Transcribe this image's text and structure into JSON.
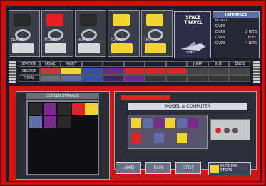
{
  "colors": {
    "bezel": "#cc1010",
    "panel_bg": "#1b1e28",
    "accent_red": "#d92727",
    "accent_yellow": "#f2d432",
    "accent_blue": "#5e6fa8"
  },
  "top_slots": [
    {
      "id": "slot-1",
      "label": "BLANK",
      "lamp": "#2a2a2a",
      "lamp_name": "black-lamp-icon"
    },
    {
      "id": "slot-2",
      "label": "MODE",
      "lamp": "#e81e25",
      "lamp_name": "red-lamp-icon"
    },
    {
      "id": "slot-3",
      "label": "ROAD",
      "lamp": "#2a2a2a",
      "lamp_name": "black-lamp-icon"
    },
    {
      "id": "slot-4",
      "label": "FORK",
      "lamp": "#f2d432",
      "lamp_name": "yellow-lamp-icon"
    },
    {
      "id": "slot-5",
      "label": "TRIP",
      "lamp": "#f2d432",
      "lamp_name": "yellow-lamp-icon"
    }
  ],
  "logo": {
    "title": "SPACE TRAVEL",
    "subtitle": "SHIP"
  },
  "stats": {
    "header": "INTERFACE",
    "rows": [
      {
        "k": "BOOST",
        "v": ""
      },
      {
        "k": "OVER",
        "v": ""
      },
      {
        "k": "OVER",
        "v": "2 BITS"
      },
      {
        "k": "OVER",
        "v": "FUEL"
      },
      {
        "k": "OVER",
        "v": "4 BITS"
      }
    ]
  },
  "grid": {
    "headers": [
      "STATION",
      "MOVE",
      "RIGHT",
      "",
      "",
      "",
      "",
      "",
      "JUMP",
      "BUG",
      "ENDS"
    ],
    "rows": [
      [
        "SECTOR",
        "",
        "",
        "",
        "",
        "",
        "",
        "",
        "",
        "",
        ""
      ],
      [
        "VIEW",
        "",
        "",
        "",
        "",
        "",
        "",
        "",
        "",
        "",
        ""
      ]
    ]
  },
  "left_panel": {
    "title": "SCREEN STORAGE"
  },
  "right_panel": {
    "title": "MODEL & COMPUTER"
  },
  "buttons": {
    "load": "LOAD",
    "run": "RUN",
    "stop": "STOP"
  },
  "status": {
    "line1": "RUNNING",
    "line2": "STOPS"
  }
}
